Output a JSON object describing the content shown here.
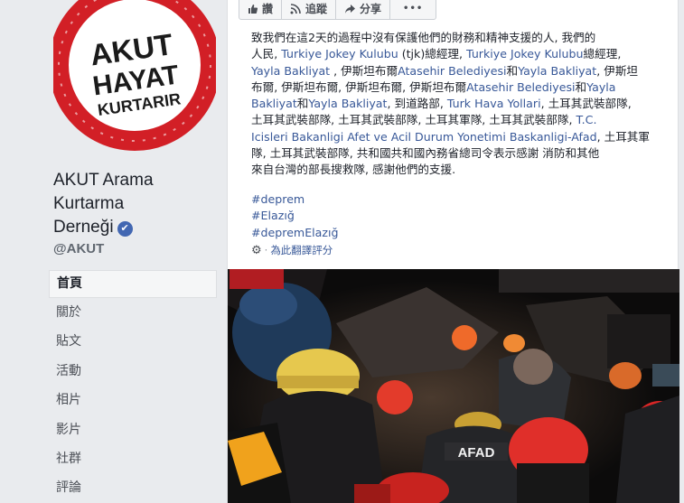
{
  "page": {
    "name_lines": [
      "AKUT Arama",
      "Kurtarma",
      "Derneği"
    ],
    "verified_glyph": "✔",
    "handle": "@AKUT"
  },
  "logo": {
    "lines": [
      "AKUT",
      "HAYAT",
      "KURTARIR"
    ],
    "ring_color": "#d21f26"
  },
  "nav": {
    "items": [
      "首頁",
      "關於",
      "貼文",
      "活動",
      "相片",
      "影片",
      "社群",
      "評論"
    ],
    "active_index": 0
  },
  "post_actions": {
    "like": "讚",
    "comment": "追蹤",
    "share": "分享",
    "more": "•••"
  },
  "post": {
    "l1": "致我們在這2天的過程中沒有保護他們的財務和精神支援的人, 我們的",
    "l2a": "人民, ",
    "l2b": "Turkiye Jokey Kulubu",
    "l2c": " (tjk)總經理, ",
    "l2d": "Turkiye Jokey Kulubu",
    "l2e": "總經理,",
    "l3a": "Yayla Bakliyat",
    "l3b": " , 伊斯坦布爾",
    "l3c": "Atasehir Belediyesi",
    "l3d": "和",
    "l3e": "Yayla Bakliyat",
    "l3f": ", 伊斯坦",
    "l4a": "布爾, 伊斯坦布爾, 伊斯坦布爾, 伊斯坦布爾",
    "l4b": "Atasehir Belediyesi",
    "l4c": "和",
    "l4d": "Yayla",
    "l5a": "Bakliyat",
    "l5b": "和",
    "l5c": "Yayla Bakliyat",
    "l5d": ", 到道路部, ",
    "l5e": "Turk Hava Yollari",
    "l5f": ", 土耳其武裝部隊,",
    "l6a": "土耳其武裝部隊, 土耳其武裝部隊, 土耳其軍隊, 土耳其武裝部隊, ",
    "l6b": "T.C.",
    "l7a": "Icisleri Bakanligi Afet ve Acil Durum Yonetimi Baskanligi-Afad",
    "l7b": ", 土耳其軍",
    "l8": "隊, 土耳其武裝部隊, 共和國共和國內務省總司令表示感謝 消防和其他",
    "l9": "來自台灣的部長搜救隊, 感謝他們的支援."
  },
  "hashtags": [
    "#deprem",
    "#Elazığ",
    "#depremElazığ"
  ],
  "translate_rating": "為此翻譯評分",
  "photo": {
    "helmet_text": "AFAD"
  },
  "colors": {
    "link": "#385898",
    "background": "#e9ebee",
    "brand_blue": "#4267b2"
  }
}
